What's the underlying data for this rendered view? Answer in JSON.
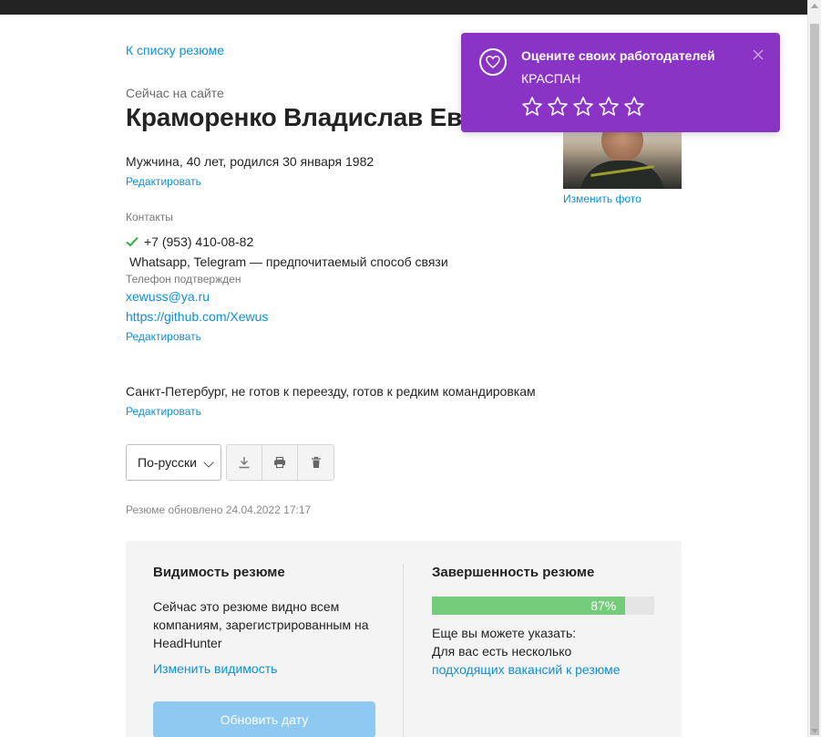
{
  "nav": {
    "back_link": "К списку резюме"
  },
  "profile": {
    "online_status": "Сейчас на сайте",
    "name": "Краморенко Владислав Евгеньевич",
    "gender_age": "Мужчина, 40 лет, родился 30 января 1982",
    "edit_label": "Редактировать",
    "change_photo": "Изменить фото"
  },
  "contacts": {
    "label": "Контакты",
    "phone": "+7 (953) 410-08-82",
    "preferred": "Whatsapp, Telegram — предпочитаемый способ связи",
    "phone_confirmed": "Телефон подтвержден",
    "email": "xewuss@ya.ru",
    "github": "https://github.com/Xewus",
    "edit_label": "Редактировать"
  },
  "location": {
    "text": "Санкт-Петербург, не готов к переезду, готов к редким командировкам",
    "edit_label": "Редактировать"
  },
  "toolbar": {
    "language": "По-русски",
    "icons": [
      "download-icon",
      "print-icon",
      "trash-icon"
    ]
  },
  "updated": "Резюме обновлено 24.04.2022 17:17",
  "visibility": {
    "title": "Видимость резюме",
    "text": "Сейчас это резюме видно всем компаниям, зарегистрированным на HeadHunter",
    "change_link": "Изменить видимость",
    "update_button": "Обновить дату"
  },
  "completeness": {
    "title": "Завершенность резюме",
    "percent": 87,
    "percent_label": "87%",
    "hint_line1": "Еще вы можете указать:",
    "hint_line2": "Для вас есть несколько",
    "hint_link": "подходящих вакансий к резюме"
  },
  "toast": {
    "title": "Оцените своих работодателей",
    "company": "КРАСПАН",
    "stars": 5
  },
  "colors": {
    "link": "#0f8fd5",
    "toast_bg": "#8a34c6",
    "progress": "#74cb7a",
    "update_button": "#8ec9f1",
    "check": "#2eaa3c"
  }
}
